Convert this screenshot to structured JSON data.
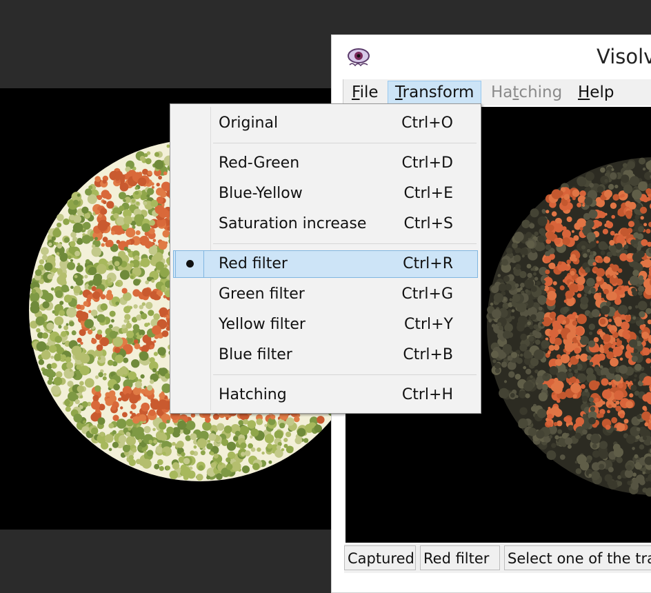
{
  "app": {
    "title": "Visolv",
    "logo_icon": "eye-logo-icon"
  },
  "menubar": {
    "items": [
      {
        "label_first": "F",
        "label_rest": "ile"
      },
      {
        "label_first": "T",
        "label_rest": "ransform"
      },
      {
        "label_pre": "Ha",
        "label_u": "t",
        "label_post": "ching"
      },
      {
        "label_first": "H",
        "label_rest": "elp"
      }
    ]
  },
  "transform_menu": {
    "items": [
      {
        "label": "Original",
        "shortcut": "Ctrl+O"
      },
      {
        "label": "Red-Green",
        "shortcut": "Ctrl+D"
      },
      {
        "label": "Blue-Yellow",
        "shortcut": "Ctrl+E"
      },
      {
        "label": "Saturation increase",
        "shortcut": "Ctrl+S"
      },
      {
        "label": "Red filter",
        "shortcut": "Ctrl+R",
        "checked": true
      },
      {
        "label": "Green filter",
        "shortcut": "Ctrl+G"
      },
      {
        "label": "Yellow filter",
        "shortcut": "Ctrl+Y"
      },
      {
        "label": "Blue filter",
        "shortcut": "Ctrl+B"
      },
      {
        "label": "Hatching",
        "shortcut": "Ctrl+H"
      }
    ]
  },
  "statusbar": {
    "source": "Captured",
    "mode": "Red filter",
    "hint": "Select one of the transformations"
  },
  "plates": {
    "left_text_hint": "green-orange Ishihara plate",
    "right_text": "FU TH CO BL"
  },
  "colors": {
    "menu_highlight": "#cde4f7",
    "menu_highlight_border": "#7fb5e0",
    "plate_green": "#8fa64a",
    "plate_orange": "#d9693a",
    "filtered_bg": "#3e3d2e",
    "filtered_orange": "#d8643a"
  }
}
